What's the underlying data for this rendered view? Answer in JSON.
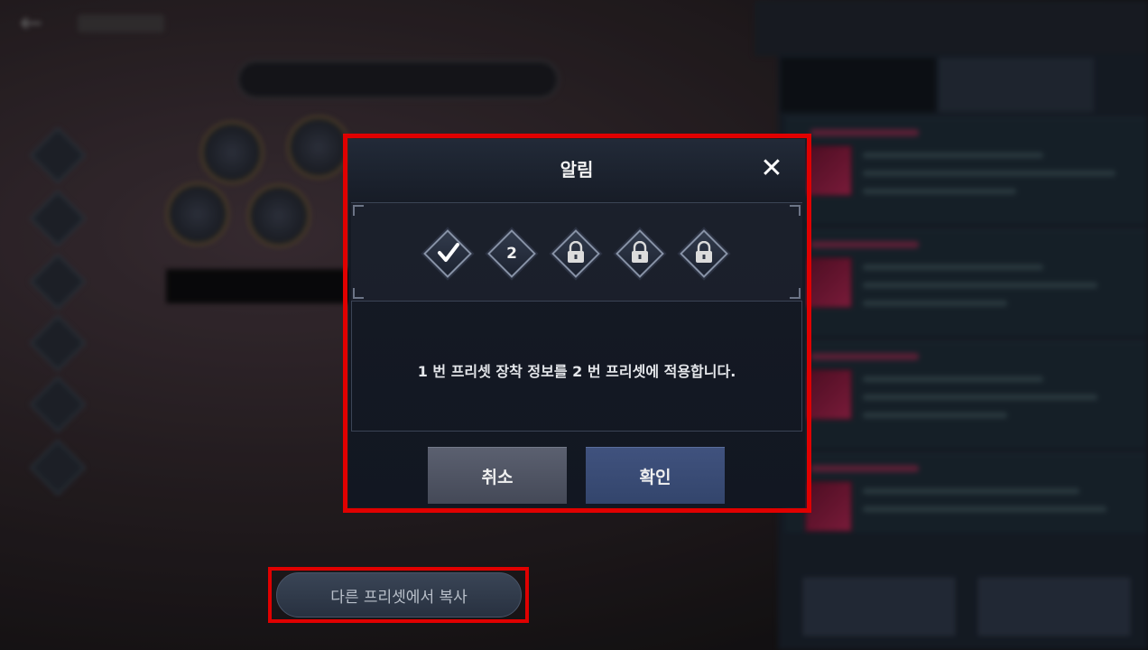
{
  "dialog": {
    "title": "알림",
    "close_icon": "close-icon",
    "message": "1 번 프리셋 장착 정보를 2 번 프리셋에 적용합니다.",
    "cancel_label": "취소",
    "confirm_label": "확인",
    "presets": [
      {
        "label": "",
        "state": "selected",
        "icon": "check-icon"
      },
      {
        "label": "2",
        "state": "target",
        "icon": ""
      },
      {
        "label": "",
        "state": "locked",
        "icon": "lock-icon"
      },
      {
        "label": "",
        "state": "locked",
        "icon": "lock-icon"
      },
      {
        "label": "",
        "state": "locked",
        "icon": "lock-icon"
      }
    ]
  },
  "copy_button": {
    "label": "다른 프리셋에서 복사"
  },
  "colors": {
    "highlight": "#e00000",
    "confirm": "#3a4c76",
    "cancel": "#50555f"
  }
}
